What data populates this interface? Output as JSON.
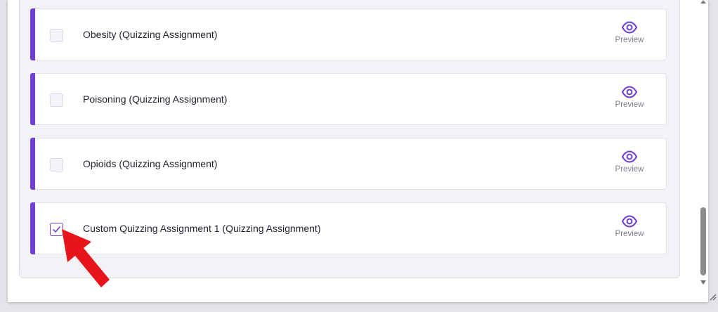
{
  "assignments": [
    {
      "title": "Obesity (Quizzing Assignment)",
      "checked": false,
      "preview_label": "Preview"
    },
    {
      "title": "Poisoning (Quizzing Assignment)",
      "checked": false,
      "preview_label": "Preview"
    },
    {
      "title": "Opioids (Quizzing Assignment)",
      "checked": false,
      "preview_label": "Preview"
    },
    {
      "title": "Custom Quizzing Assignment 1 (Quizzing Assignment)",
      "checked": true,
      "preview_label": "Preview"
    }
  ],
  "icons": {
    "preview": "eye-icon",
    "checked": "checkmark-icon",
    "annotation": "red-arrow-icon"
  },
  "colors": {
    "accent": "#6f3fd6",
    "annotation_arrow": "#e8141b",
    "preview_text": "#7b7f8c"
  }
}
